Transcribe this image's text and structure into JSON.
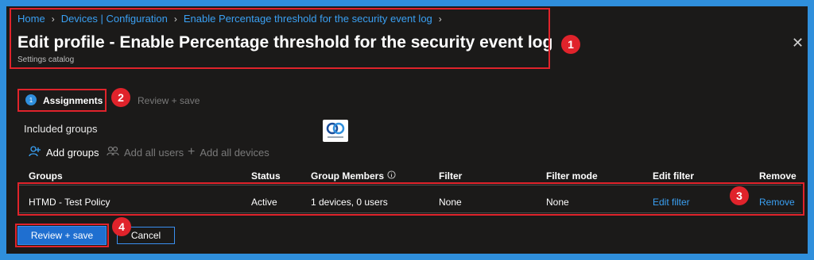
{
  "breadcrumb": {
    "items": [
      "Home",
      "Devices | Configuration",
      "Enable Percentage threshold for the security event log"
    ]
  },
  "page": {
    "title": "Edit profile - Enable Percentage threshold for the security event log",
    "subtitle": "Settings catalog"
  },
  "steps": {
    "assignments_num": "1",
    "assignments_label": "Assignments",
    "review_label": "Review + save"
  },
  "annotations": [
    "1",
    "2",
    "3",
    "4"
  ],
  "section": {
    "title": "Included groups"
  },
  "toolbar": {
    "add_groups": "Add groups",
    "add_all_users": "Add all users",
    "add_all_devices": "Add all devices"
  },
  "table": {
    "headers": [
      "Groups",
      "Status",
      "Group Members",
      "Filter",
      "Filter mode",
      "Edit filter",
      "Remove"
    ],
    "rows": [
      {
        "group": "HTMD - Test Policy",
        "status": "Active",
        "members": "1 devices, 0 users",
        "filter": "None",
        "filter_mode": "None",
        "edit_filter": "Edit filter",
        "remove": "Remove"
      }
    ]
  },
  "footer": {
    "review_save": "Review + save",
    "cancel": "Cancel"
  },
  "colors": {
    "accent": "#3aa0f3",
    "annotation": "#e0232b",
    "background": "#1b1a19",
    "frame": "#2f8fdc"
  },
  "icons": [
    "chevron-right-icon",
    "close-icon",
    "person-add-icon",
    "people-icon",
    "plus-icon",
    "info-icon"
  ]
}
